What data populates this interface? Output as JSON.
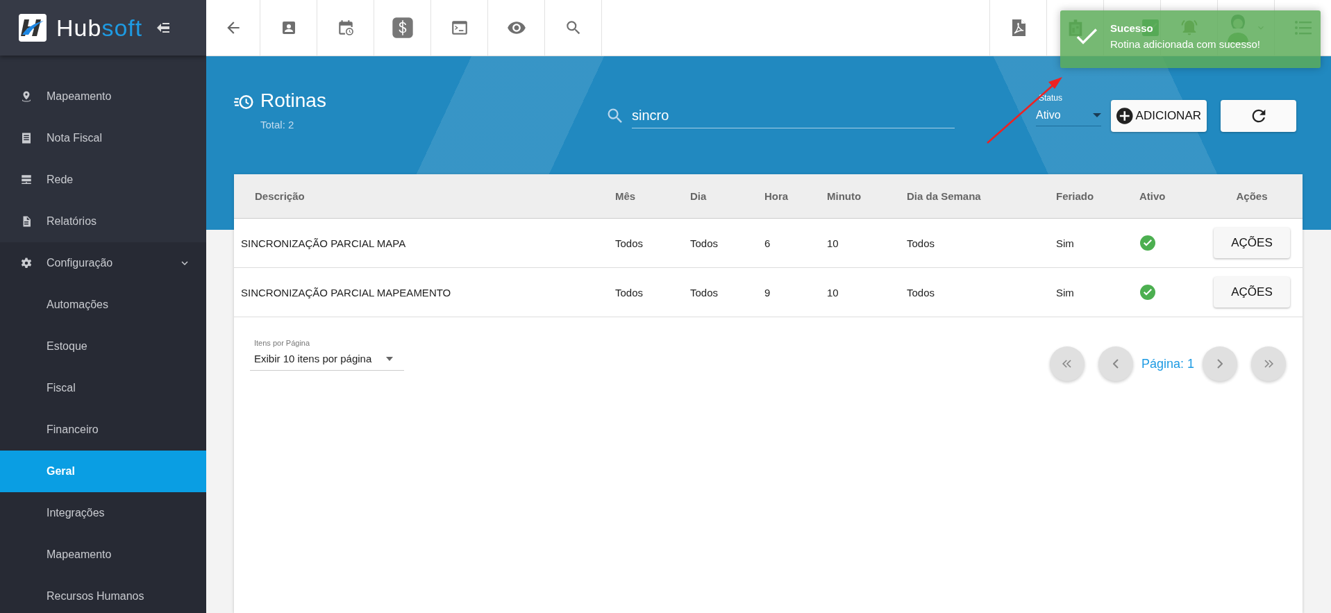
{
  "sidebar": {
    "brand": {
      "first": "Hub",
      "second": "soft"
    },
    "items": [
      {
        "label": "Mapeamento",
        "selected": false
      },
      {
        "label": "Nota Fiscal",
        "selected": false
      },
      {
        "label": "Rede",
        "selected": false
      },
      {
        "label": "Relatórios",
        "selected": false
      },
      {
        "label": "Configuração",
        "selected": false,
        "expanded": true,
        "children": [
          {
            "label": "Automações",
            "selected": false
          },
          {
            "label": "Estoque",
            "selected": false
          },
          {
            "label": "Fiscal",
            "selected": false
          },
          {
            "label": "Financeiro",
            "selected": false
          },
          {
            "label": "Geral",
            "selected": true
          },
          {
            "label": "Integrações",
            "selected": false
          },
          {
            "label": "Mapeamento",
            "selected": false
          },
          {
            "label": "Recursos Humanos",
            "selected": false
          }
        ]
      }
    ]
  },
  "toast": {
    "kind": "success",
    "title": "Sucesso",
    "message": "Rotina adicionada com sucesso!"
  },
  "page": {
    "title": "Rotinas",
    "subtitle": "Total: 2",
    "search": {
      "value": "sincro"
    },
    "status": {
      "label": "Status",
      "value": "Ativo"
    },
    "add_button": "ADICIONAR"
  },
  "table": {
    "columns": [
      "Descrição",
      "Mês",
      "Dia",
      "Hora",
      "Minuto",
      "Dia da Semana",
      "Feriado",
      "Ativo",
      "Ações"
    ],
    "rows": [
      {
        "cells": [
          "SINCRONIZAÇÃO PARCIAL MAPA",
          "Todos",
          "Todos",
          "6",
          "10",
          "Todos",
          "Sim"
        ],
        "active": true,
        "action": "AÇÕES"
      },
      {
        "cells": [
          "SINCRONIZAÇÃO PARCIAL MAPEAMENTO",
          "Todos",
          "Todos",
          "9",
          "10",
          "Todos",
          "Sim"
        ],
        "active": true,
        "action": "AÇÕES"
      }
    ]
  },
  "pagination": {
    "per_page_label": "Itens por Página",
    "per_page_value": "Exibir 10 itens por página",
    "page_label": "Página: 1"
  }
}
